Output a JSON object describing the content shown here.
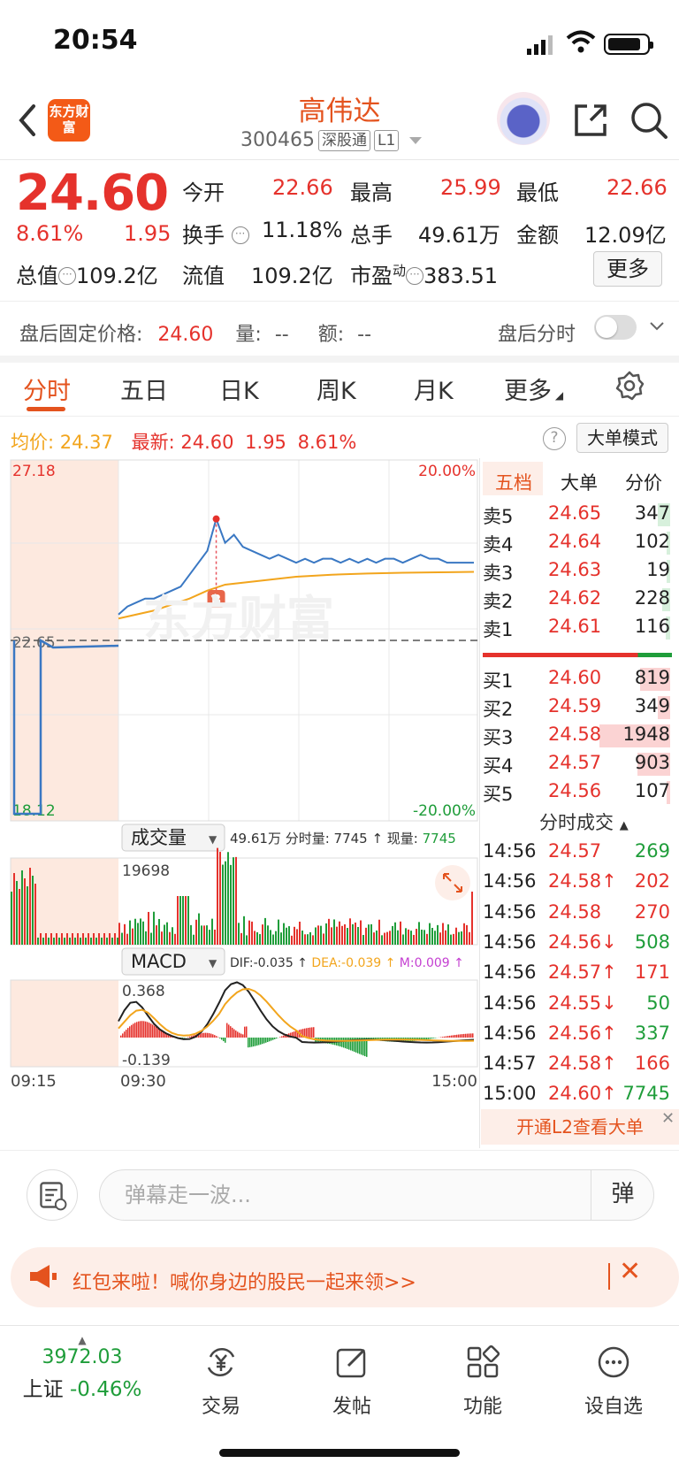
{
  "status_bar": {
    "time": "20:54"
  },
  "header": {
    "logo_text": "东方财富",
    "stock_name": "高伟达",
    "code": "300465",
    "tag_connect": "深股通",
    "tag_level": "L1"
  },
  "quote": {
    "price": "24.60",
    "change_pct": "8.61%",
    "change": "1.95",
    "open_label": "今开",
    "open": "22.66",
    "high_label": "最高",
    "high": "25.99",
    "low_label": "最低",
    "low": "22.66",
    "turnover_label": "换手",
    "turnover": "11.18%",
    "volume_label": "总手",
    "volume": "49.61万",
    "amount_label": "金额",
    "amount": "12.09亿",
    "mktcap_label": "总值",
    "mktcap": "109.2亿",
    "float_label": "流值",
    "float": "109.2亿",
    "pe_label": "市盈",
    "pe_sup": "动",
    "pe": "383.51",
    "more_label": "更多"
  },
  "after_hours": {
    "label": "盘后固定价格:",
    "price": "24.60",
    "vol_label": "量:",
    "vol": "--",
    "amt_label": "额:",
    "amt": "--",
    "timeline_label": "盘后分时"
  },
  "tabs": [
    "分时",
    "五日",
    "日K",
    "周K",
    "月K",
    "更多"
  ],
  "info": {
    "avg_label": "均价:",
    "avg": "24.37",
    "latest_label": "最新:",
    "latest": "24.60",
    "latest_chg": "1.95",
    "latest_pct": "8.61%",
    "bigmode_label": "大单模式"
  },
  "chart_data": {
    "type": "line",
    "price_axis": {
      "top": "27.18",
      "mid": "22.65",
      "bottom": "18.12",
      "top_pct": "20.00%",
      "bottom_pct": "-20.00%",
      "ylim": [
        18.12,
        27.18
      ],
      "prev_close": 22.65
    },
    "x_ticks": [
      "09:15",
      "09:30",
      "15:00"
    ],
    "series": [
      {
        "name": "price",
        "color": "#3a78c3",
        "x": [
          0,
          1,
          2,
          3,
          4,
          5,
          6,
          7,
          8,
          9,
          10,
          11,
          12,
          13,
          14,
          15,
          16,
          17,
          18,
          19,
          20,
          21,
          22,
          23,
          24,
          25,
          26,
          27,
          28,
          29,
          30,
          31,
          32,
          33,
          34,
          35,
          36,
          37,
          38,
          39,
          40
        ],
        "values": [
          23.3,
          23.5,
          23.6,
          23.7,
          23.7,
          23.8,
          23.9,
          24.0,
          24.3,
          24.6,
          24.9,
          25.7,
          25.1,
          25.3,
          25.0,
          24.9,
          24.8,
          24.7,
          24.8,
          24.7,
          24.6,
          24.7,
          24.6,
          24.7,
          24.7,
          24.6,
          24.7,
          24.6,
          24.7,
          24.6,
          24.7,
          24.7,
          24.6,
          24.7,
          24.8,
          24.7,
          24.7,
          24.6,
          24.6,
          24.6,
          24.6
        ]
      },
      {
        "name": "avg",
        "color": "#f2a51d",
        "x": [
          0,
          4,
          8,
          10,
          12,
          16,
          20,
          24,
          28,
          32,
          36,
          40
        ],
        "values": [
          23.2,
          23.4,
          23.7,
          23.9,
          24.05,
          24.15,
          24.25,
          24.3,
          24.33,
          24.35,
          24.36,
          24.37
        ]
      }
    ],
    "marker": {
      "label": "B"
    },
    "volume": {
      "label": "成交量",
      "summary": "49.61万",
      "tick_vol_label": "分时量:",
      "tick_vol": "7745",
      "now_vol_label": "现量:",
      "now_vol": "7745",
      "max": "19698"
    },
    "macd": {
      "label": "MACD",
      "dif_label": "DIF:",
      "dif": "-0.035",
      "dea_label": "DEA:",
      "dea": "-0.039",
      "m_label": "M:",
      "m": "0.009",
      "top": "0.368",
      "bottom": "-0.139"
    }
  },
  "order_book": {
    "tabs": [
      "五档",
      "大单",
      "分价"
    ],
    "asks": [
      {
        "label": "卖5",
        "price": "24.65",
        "vol": "347"
      },
      {
        "label": "卖4",
        "price": "24.64",
        "vol": "102"
      },
      {
        "label": "卖3",
        "price": "24.63",
        "vol": "19"
      },
      {
        "label": "卖2",
        "price": "24.62",
        "vol": "228"
      },
      {
        "label": "卖1",
        "price": "24.61",
        "vol": "116"
      }
    ],
    "bids": [
      {
        "label": "买1",
        "price": "24.60",
        "vol": "819"
      },
      {
        "label": "买2",
        "price": "24.59",
        "vol": "349"
      },
      {
        "label": "买3",
        "price": "24.58",
        "vol": "1948"
      },
      {
        "label": "买4",
        "price": "24.57",
        "vol": "903"
      },
      {
        "label": "买5",
        "price": "24.56",
        "vol": "107"
      }
    ],
    "trades_title": "分时成交",
    "trades": [
      {
        "time": "14:56",
        "price": "24.57",
        "arrow": "",
        "vol": "269",
        "color": "#1f9d3a"
      },
      {
        "time": "14:56",
        "price": "24.58↑",
        "arrow": "",
        "vol": "202",
        "color": "#e5322c"
      },
      {
        "time": "14:56",
        "price": "24.58",
        "arrow": "",
        "vol": "270",
        "color": "#e5322c"
      },
      {
        "time": "14:56",
        "price": "24.56↓",
        "arrow": "",
        "vol": "508",
        "color": "#1f9d3a"
      },
      {
        "time": "14:56",
        "price": "24.57↑",
        "arrow": "",
        "vol": "171",
        "color": "#e5322c"
      },
      {
        "time": "14:56",
        "price": "24.55↓",
        "arrow": "",
        "vol": "50",
        "color": "#1f9d3a"
      },
      {
        "time": "14:56",
        "price": "24.56↑",
        "arrow": "",
        "vol": "337",
        "color": "#1f9d3a"
      },
      {
        "time": "14:57",
        "price": "24.58↑",
        "arrow": "",
        "vol": "166",
        "color": "#e5322c"
      },
      {
        "time": "15:00",
        "price": "24.60↑",
        "arrow": "",
        "vol": "7745",
        "color": "#1f9d3a"
      }
    ],
    "l2_label": "开通L2查看大单"
  },
  "danmu": {
    "placeholder": "弹幕走一波...",
    "button": "弹"
  },
  "banner": {
    "text": "红包来啦！喊你身边的股民一起来领>>"
  },
  "bottom_nav": {
    "index_value": "3972.03",
    "index_name": "上证",
    "index_pct": "-0.46%",
    "items": [
      "交易",
      "发帖",
      "功能",
      "设自选"
    ]
  },
  "colors": {
    "up": "#e5322c",
    "down": "#1f9d3a",
    "accent": "#e4531e",
    "price_line": "#3a78c3",
    "avg_line": "#f2a51d"
  }
}
